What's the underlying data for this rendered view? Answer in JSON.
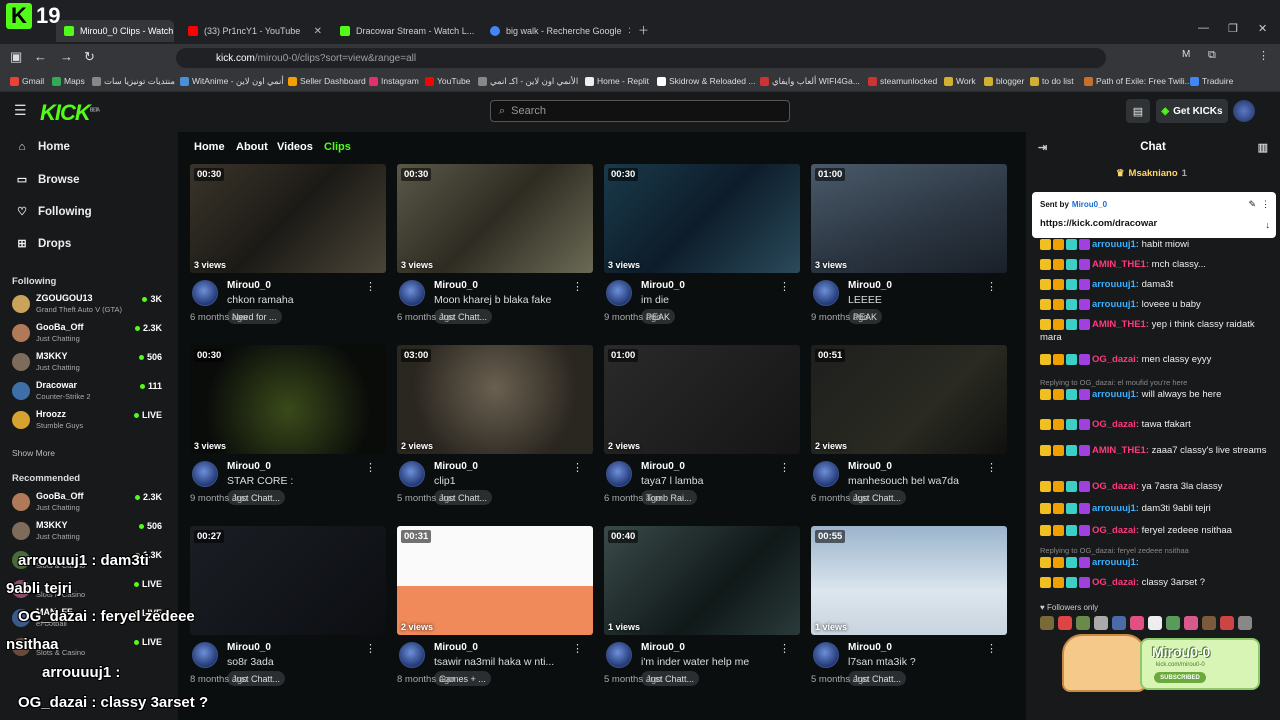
{
  "browser": {
    "tab_count": "19",
    "tabs": [
      {
        "title": "Mirou0_0 Clips - Watch Live"
      },
      {
        "title": "(33) Pr1ncY1 - YouTube"
      },
      {
        "title": "Dracowar Stream - Watch L..."
      },
      {
        "title": "big walk - Recherche Google"
      }
    ],
    "url_host": "kick.com",
    "url_path": "/mirou0-0/clips?sort=view&range=all",
    "bookmarks": [
      "Gmail",
      "Maps",
      "منتديات تونيزيا سات",
      "WitAnime - أنمي اون لاين",
      "Seller Dashboard",
      "Instagram",
      "YouTube",
      "الأنمي اون لاين - اكـ انمي",
      "Home - Replit",
      "Skidrow & Reloaded ...",
      "ألعاب وايفاي WIFI4Ga...",
      "steamunlocked",
      "Work",
      "blogger",
      "to do list",
      "Path of Exile: Free Twili...",
      "Traduire"
    ]
  },
  "header": {
    "logo": "KICK",
    "logo_sup": "BETA",
    "search_placeholder": "Search",
    "get_kicks": "Get KICKs"
  },
  "sidebar": {
    "nav": [
      "Home",
      "Browse",
      "Following",
      "Drops"
    ],
    "following_title": "Following",
    "following": [
      {
        "name": "ZGOUGOU13",
        "game": "Grand Theft Auto V (GTA)",
        "viewers": "3K",
        "color": "#c9a35a"
      },
      {
        "name": "GooBa_Off",
        "game": "Just Chatting",
        "viewers": "2.3K",
        "color": "#b07a58"
      },
      {
        "name": "M3KKY",
        "game": "Just Chatting",
        "viewers": "506",
        "color": "#7d6c5a"
      },
      {
        "name": "Dracowar",
        "game": "Counter-Strike 2",
        "viewers": "111",
        "color": "#3e6fa8"
      },
      {
        "name": "Hroozz",
        "game": "Stumble Guys",
        "viewers": "LIVE",
        "color": "#d6a230"
      }
    ],
    "show_more": "Show More",
    "recommended_title": "Recommended",
    "recommended": [
      {
        "name": "GooBa_Off",
        "game": "Just Chatting",
        "viewers": "2.3K",
        "color": "#b07a58"
      },
      {
        "name": "M3KKY",
        "game": "Just Chatting",
        "viewers": "506",
        "color": "#7d6c5a"
      },
      {
        "name": "",
        "game": "Slots & Casino",
        "viewers": "1.3K",
        "color": "#4a6a3a"
      },
      {
        "name": "",
        "game": "Slots & Casino",
        "viewers": "LIVE",
        "color": "#8a4a6a"
      },
      {
        "name": "MAN_FF",
        "game": "eFootball",
        "viewers": "LIVE",
        "color": "#3a5a8a"
      },
      {
        "name": "",
        "game": "Slots & Casino",
        "viewers": "LIVE",
        "color": "#6a4a3a"
      }
    ]
  },
  "main": {
    "tabs": [
      "Home",
      "About",
      "Videos",
      "Clips"
    ],
    "clips": [
      {
        "duration": "00:30",
        "views": "3 views",
        "user": "Mirou0_0",
        "title": "chkon ramaha",
        "tag": "Need for ...",
        "age": "6 months ago",
        "bg": "linear-gradient(135deg,#3a352b,#1c1a16 50%,#4a4538)"
      },
      {
        "duration": "00:30",
        "views": "3 views",
        "user": "Mirou0_0",
        "title": "Moon kharej b blaka fake",
        "tag": "Just Chatt...",
        "age": "6 months ago",
        "bg": "linear-gradient(135deg,#5a5848,#2e2c22 50%,#6b6a55)"
      },
      {
        "duration": "00:30",
        "views": "3 views",
        "user": "Mirou0_0",
        "title": "im die",
        "tag": "PEAK",
        "age": "9 months ago",
        "bg": "linear-gradient(135deg,#1a3a4a,#0d1c2a 50%,#2a4a5a)"
      },
      {
        "duration": "01:00",
        "views": "3 views",
        "user": "Mirou0_0",
        "title": "LEEEE",
        "tag": "PEAK",
        "age": "9 months ago",
        "bg": "linear-gradient(160deg,#4a5a6a,#2a3440 60%,#1a2028)"
      },
      {
        "duration": "00:30",
        "views": "3 views",
        "user": "Mirou0_0",
        "title": "STAR CORE :",
        "tag": "Just Chatt...",
        "age": "9 months ago",
        "bg": "radial-gradient(circle at 50% 60%,#3a4a1a,#0a0c0a 70%)"
      },
      {
        "duration": "03:00",
        "views": "2 views",
        "user": "Mirou0_0",
        "title": "clip1",
        "tag": "Just Chatt...",
        "age": "5 months ago",
        "bg": "radial-gradient(circle at 50% 40%,#6a6050,#2a2620 70%)"
      },
      {
        "duration": "01:00",
        "views": "2 views",
        "user": "Mirou0_0",
        "title": "taya7 l lamba",
        "tag": "Tomb Rai...",
        "age": "6 months ago",
        "bg": "linear-gradient(135deg,#2a2a2a,#151515)"
      },
      {
        "duration": "00:51",
        "views": "2 views",
        "user": "Mirou0_0",
        "title": "manhesouch bel wa7da",
        "tag": "Just Chatt...",
        "age": "6 months ago",
        "bg": "linear-gradient(135deg,#1e1e1e,#2a2a22 60%,#101010)"
      },
      {
        "duration": "00:27",
        "views": "",
        "user": "Mirou0_0",
        "title": "so8r 3ada",
        "tag": "Just Chatt...",
        "age": "8 months ago",
        "bg": "linear-gradient(135deg,#1a1e24,#0c0e12)"
      },
      {
        "duration": "00:31",
        "views": "2 views",
        "user": "Mirou0_0",
        "title": "tsawir na3mil haka w nti...",
        "tag": "Games + ...",
        "age": "8 months ago",
        "bg": "linear-gradient(180deg,#fafafa 0%,#fafafa 55%,#f08a5a 55%)"
      },
      {
        "duration": "00:40",
        "views": "1 views",
        "user": "Mirou0_0",
        "title": "i'm inder water help me",
        "tag": "Just Chatt...",
        "age": "5 months ago",
        "bg": "linear-gradient(135deg,#3a4a4a,#101818 60%,#2a3a3a)"
      },
      {
        "duration": "00:55",
        "views": "1 views",
        "user": "Mirou0_0",
        "title": "l7san mta3ik ?",
        "tag": "Just Chatt...",
        "age": "5 months ago",
        "bg": "linear-gradient(180deg,#9ab4cc,#dce6ee 60%,#c8d4de)"
      }
    ]
  },
  "chat": {
    "title": "Chat",
    "gifter": "Msakniano",
    "gifter_count": "1",
    "pinned_sent_by": "Sent by",
    "pinned_user": "Mirou0_0",
    "pinned_link": "https://kick.com/dracowar",
    "messages": [
      {
        "user": "arrouuuj1:",
        "text": "habit miowi",
        "color": "#3ab0ff",
        "level": "13"
      },
      {
        "user": "AMIN_THE1:",
        "text": "mch classy...",
        "color": "#ff3a7a",
        "level": "26"
      },
      {
        "user": "arrouuuj1:",
        "text": "dama3t",
        "color": "#3ab0ff",
        "level": "13"
      },
      {
        "user": "arrouuuj1:",
        "text": "loveee u baby",
        "color": "#3ab0ff",
        "level": "13"
      },
      {
        "user": "AMIN_THE1:",
        "text": "yep i think classy raidatk mara",
        "color": "#ff3a7a",
        "level": "26"
      },
      {
        "user": "OG_dazai:",
        "text": "men classy eyyy",
        "color": "#ff3a7a",
        "level": "33"
      },
      {
        "user": "arrouuuj1:",
        "text": "will always be here",
        "color": "#3ab0ff",
        "level": "13"
      },
      {
        "user": "OG_dazai:",
        "text": "tawa tfakart",
        "color": "#ff3a7a",
        "level": "33"
      },
      {
        "user": "AMIN_THE1:",
        "text": "zaaa7 classy's live streams",
        "color": "#ff3a7a",
        "level": "26"
      },
      {
        "user": "OG_dazai:",
        "text": "ya 7asra 3la classy",
        "color": "#ff3a7a",
        "level": "33"
      },
      {
        "user": "arrouuuj1:",
        "text": "dam3ti 9abli tejri",
        "color": "#3ab0ff",
        "level": "13"
      },
      {
        "user": "OG_dazai:",
        "text": "feryel zedeee nsithaa",
        "color": "#ff3a7a",
        "level": "33"
      },
      {
        "user": "arrouuuj1:",
        "text": "",
        "color": "#3ab0ff",
        "level": "13"
      },
      {
        "user": "OG_dazai:",
        "text": "classy 3arset ?",
        "color": "#ff3a7a",
        "level": "33"
      }
    ],
    "reply1": "Replying to OG_dazai: el moufid you're here",
    "reply2": "Replying to OG_dazai: feryel zedeee nsithaa",
    "followers_only": "Followers only"
  },
  "overlay": {
    "lines": [
      "arrouuuj1 : dam3ti",
      "9abli tejri",
      "OG_dazai : feryel zedeee",
      "nsithaa",
      "arrouuuj1 :",
      "OG_dazai : classy 3arset ?"
    ],
    "sticker_name": "Mirou0-0",
    "sticker_sub": "kick.com/mirou0-0",
    "sticker_btn": "SUBSCRIBED"
  }
}
